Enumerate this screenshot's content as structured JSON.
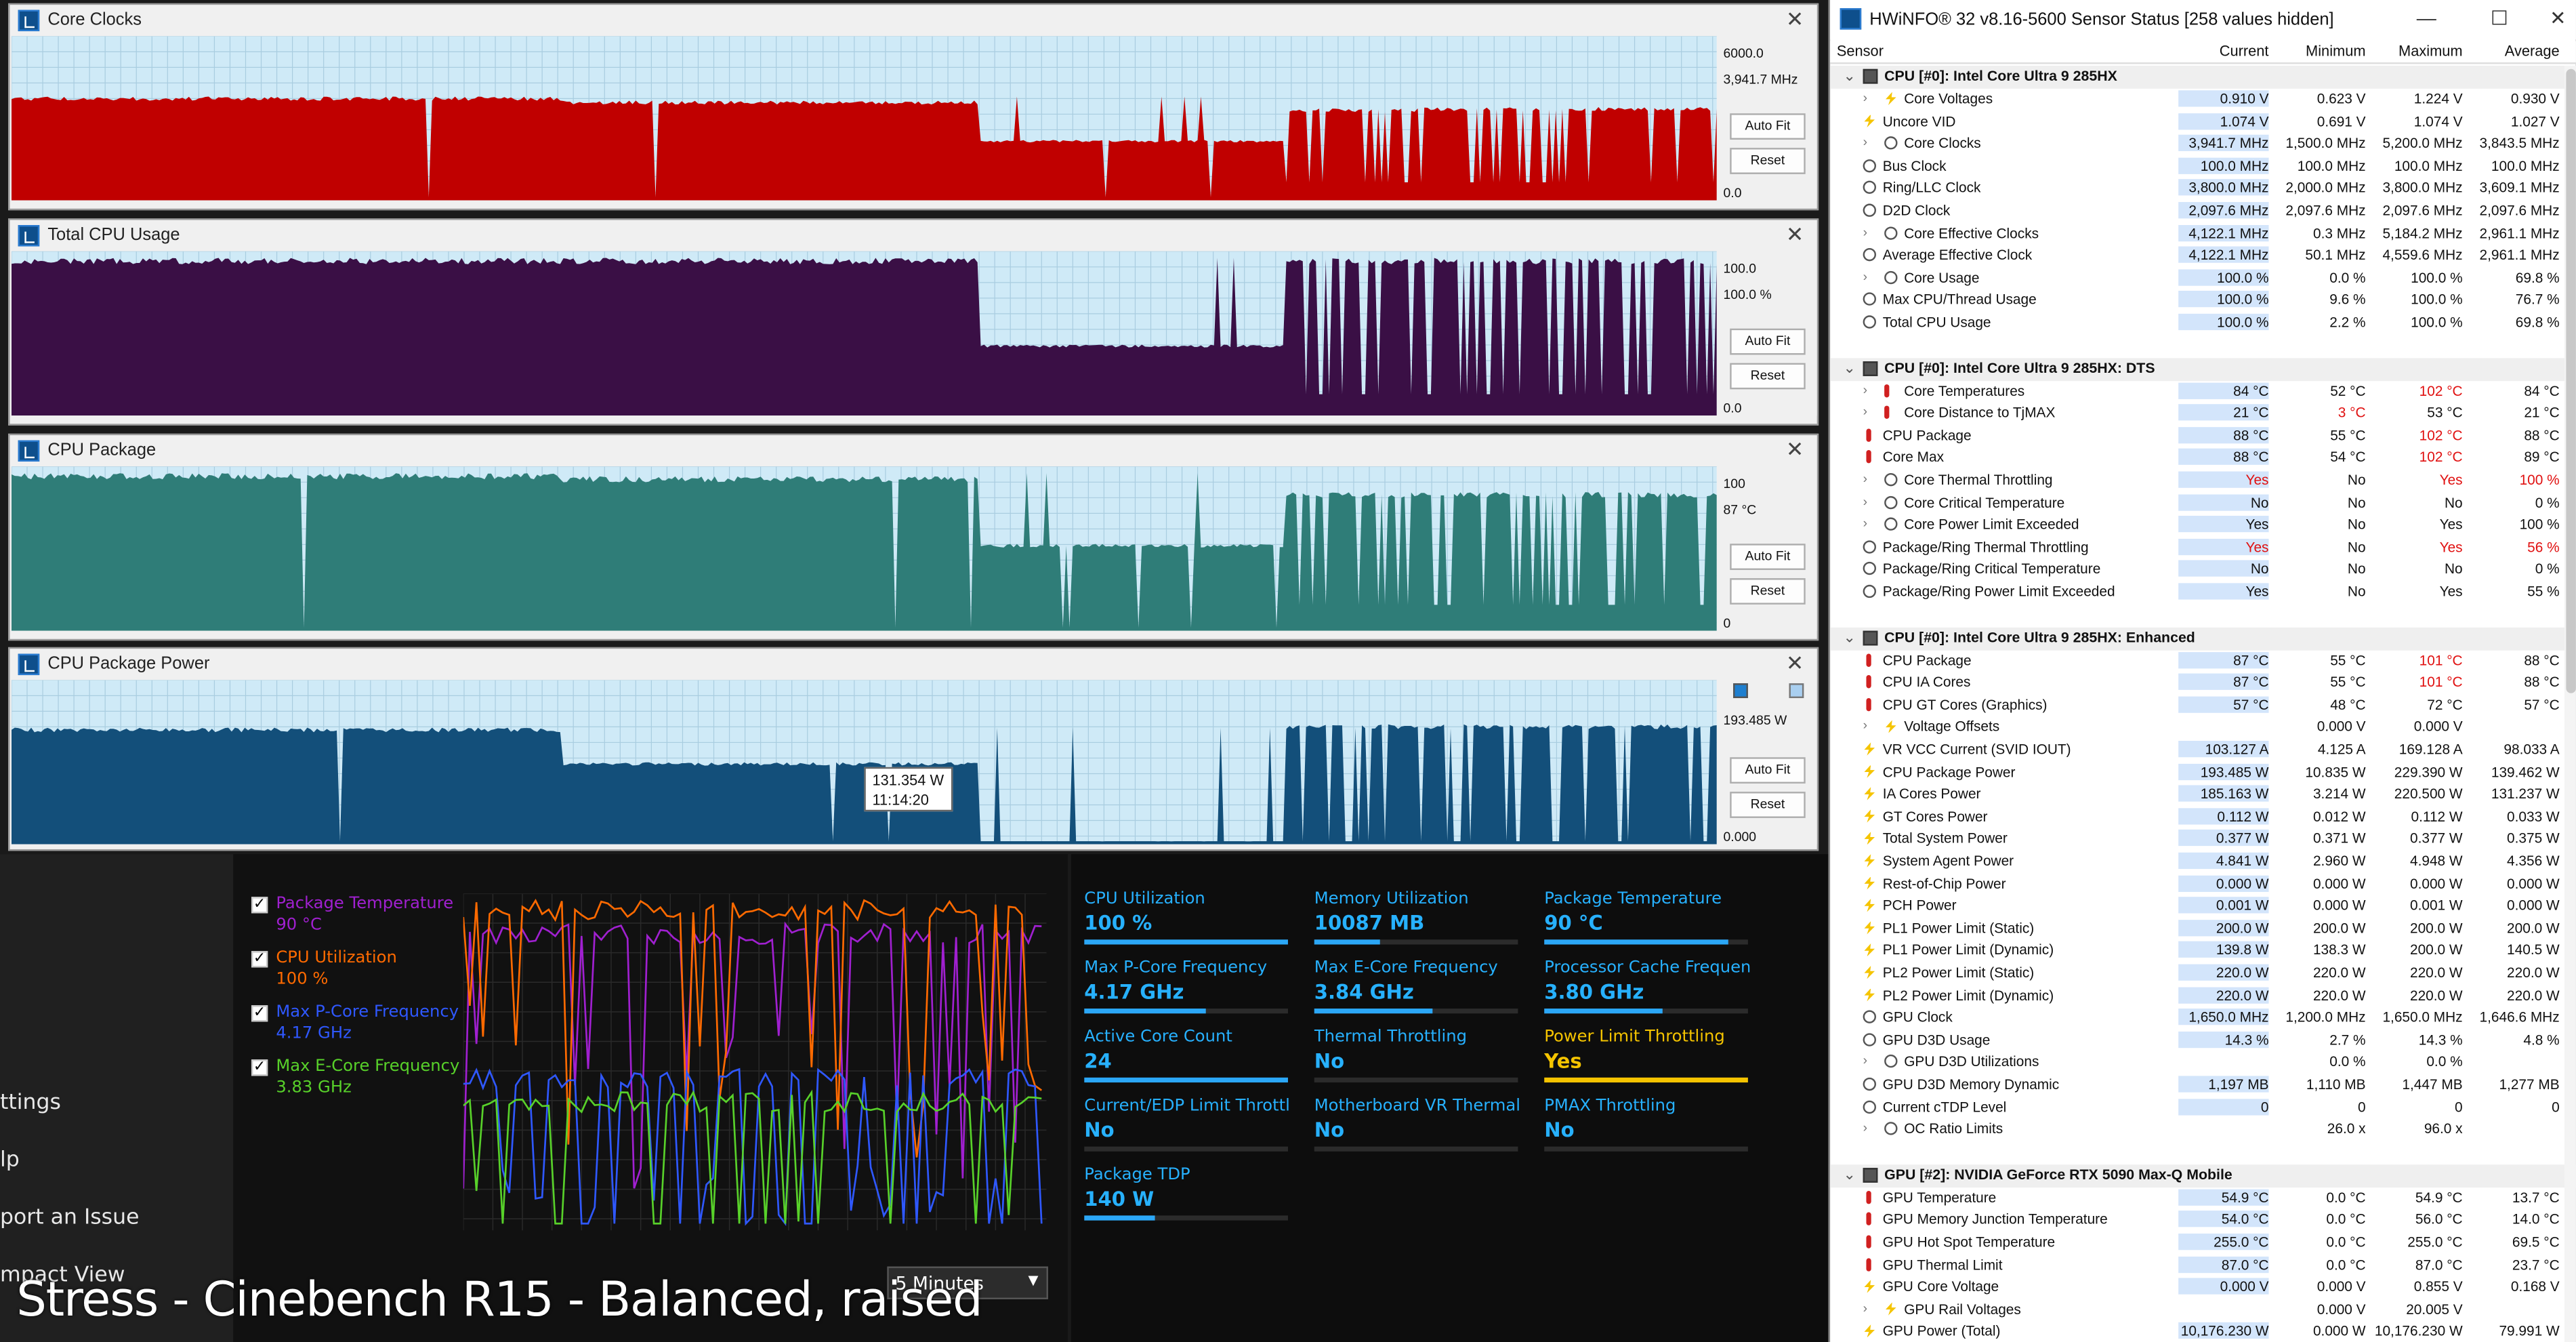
{
  "caption": "Stress - Cinebench R15 - Balanced, raised",
  "background_app": {
    "menu": [
      "ttings",
      "lp",
      "port an Issue",
      "mpact View"
    ],
    "legend": [
      {
        "name": "Package Temperature",
        "value": "90 °C",
        "color": "#a020d0"
      },
      {
        "name": "CPU Utilization",
        "value": "100 %",
        "color": "#ff6a00"
      },
      {
        "name": "Max P-Core Frequency",
        "value": "4.17 GHz",
        "color": "#2f58ff"
      },
      {
        "name": "Max E-Core Frequency",
        "value": "3.83 GHz",
        "color": "#58d12a"
      }
    ],
    "time_range": "5 Minutes",
    "stats": [
      {
        "label": "CPU Utilization",
        "value": "100 %",
        "level": 1.0
      },
      {
        "label": "Memory Utilization",
        "value": "10087 MB",
        "level": 0.32
      },
      {
        "label": "Package Temperature",
        "value": "90 °C",
        "level": 0.9
      },
      {
        "label": "Max P-Core Frequency",
        "value": "4.17 GHz",
        "level": 0.6
      },
      {
        "label": "Max E-Core Frequency",
        "value": "3.84 GHz",
        "level": 0.58
      },
      {
        "label": "Processor Cache Frequency",
        "value": "3.80 GHz",
        "level": 0.58
      },
      {
        "label": "Active Core Count",
        "value": "24",
        "level": 1.0
      },
      {
        "label": "Thermal Throttling",
        "value": "No",
        "level": 0
      },
      {
        "label": "Power Limit Throttling",
        "value": "Yes",
        "level": 1.0,
        "alert": true
      },
      {
        "label": "Current/EDP Limit Throttli...",
        "value": "No",
        "level": 0
      },
      {
        "label": "Motherboard VR Thermal...",
        "value": "No",
        "level": 0
      },
      {
        "label": "PMAX Throttling",
        "value": "No",
        "level": 0
      },
      {
        "label": "Package TDP",
        "value": "140 W",
        "level": 0.35
      }
    ]
  },
  "graphs": [
    {
      "title": "Core Clocks",
      "max": "6000.0",
      "current": "3,941.7 MHz",
      "min": "0.0",
      "color": "#c00000",
      "scale_max": 6000,
      "levels": {
        "a": 3950,
        "b": 3800,
        "c": 2300,
        "d": 3500,
        "e": 3550
      }
    },
    {
      "title": "Total CPU Usage",
      "max": "100.0",
      "current": "100.0 %",
      "min": "0.0",
      "color": "#3a0f45",
      "scale_max": 100,
      "levels": {
        "a": 100,
        "b": 100,
        "c": 45,
        "d": 100,
        "e": 100
      }
    },
    {
      "title": "CPU Package",
      "max": "100",
      "current": "87 °C",
      "min": "0",
      "color": "#2f7d78",
      "scale_max": 100,
      "levels": {
        "a": 100,
        "b": 98,
        "c": 55,
        "d": 88,
        "e": 88
      }
    },
    {
      "title": "CPU Package Power",
      "max": "",
      "current": "193.485 W",
      "min": "0.000",
      "color": "#134f7a",
      "scale_max": 250,
      "levels": {
        "a": 185,
        "b": 130,
        "c": 5,
        "d": 190,
        "e": 190
      }
    }
  ],
  "graph_buttons": {
    "auto_fit": "Auto Fit",
    "reset": "Reset"
  },
  "tooltip": {
    "value": "131.354 W",
    "time": "11:14:20"
  },
  "hwinfo": {
    "title": "HWiNFO® 32 v8.16-5600 Sensor Status [258 values hidden]",
    "columns": [
      "Sensor",
      "Current",
      "Minimum",
      "Maximum",
      "Average"
    ],
    "groups": [
      {
        "title": "CPU [#0]: Intel Core Ultra 9 285HX",
        "rows": [
          {
            "name": "Core Voltages",
            "icon": "bolt",
            "exp": true,
            "v": [
              "0.910 V",
              "0.623 V",
              "1.224 V",
              "0.930 V"
            ]
          },
          {
            "name": "Uncore VID",
            "icon": "bolt",
            "v": [
              "1.074 V",
              "0.691 V",
              "1.074 V",
              "1.027 V"
            ]
          },
          {
            "name": "Core Clocks",
            "icon": "clock",
            "exp": true,
            "v": [
              "3,941.7 MHz",
              "1,500.0 MHz",
              "5,200.0 MHz",
              "3,843.5 MHz"
            ]
          },
          {
            "name": "Bus Clock",
            "icon": "clock",
            "v": [
              "100.0 MHz",
              "100.0 MHz",
              "100.0 MHz",
              "100.0 MHz"
            ]
          },
          {
            "name": "Ring/LLC Clock",
            "icon": "clock",
            "v": [
              "3,800.0 MHz",
              "2,000.0 MHz",
              "3,800.0 MHz",
              "3,609.1 MHz"
            ]
          },
          {
            "name": "D2D Clock",
            "icon": "clock",
            "v": [
              "2,097.6 MHz",
              "2,097.6 MHz",
              "2,097.6 MHz",
              "2,097.6 MHz"
            ]
          },
          {
            "name": "Core Effective Clocks",
            "icon": "clock",
            "exp": true,
            "v": [
              "4,122.1 MHz",
              "0.3 MHz",
              "5,184.2 MHz",
              "2,961.1 MHz"
            ]
          },
          {
            "name": "Average Effective Clock",
            "icon": "clock",
            "v": [
              "4,122.1 MHz",
              "50.1 MHz",
              "4,559.6 MHz",
              "2,961.1 MHz"
            ]
          },
          {
            "name": "Core Usage",
            "icon": "clock",
            "exp": true,
            "v": [
              "100.0 %",
              "0.0 %",
              "100.0 %",
              "69.8 %"
            ]
          },
          {
            "name": "Max CPU/Thread Usage",
            "icon": "clock",
            "v": [
              "100.0 %",
              "9.6 %",
              "100.0 %",
              "76.7 %"
            ]
          },
          {
            "name": "Total CPU Usage",
            "icon": "clock",
            "v": [
              "100.0 %",
              "2.2 %",
              "100.0 %",
              "69.8 %"
            ]
          }
        ]
      },
      {
        "title": "CPU [#0]: Intel Core Ultra 9 285HX: DTS",
        "rows": [
          {
            "name": "Core Temperatures",
            "icon": "therm",
            "exp": true,
            "v": [
              "84 °C",
              "52 °C",
              "102 °C",
              "84 °C"
            ],
            "red": [
              2
            ]
          },
          {
            "name": "Core Distance to TjMAX",
            "icon": "therm",
            "exp": true,
            "v": [
              "21 °C",
              "3 °C",
              "53 °C",
              "21 °C"
            ],
            "red": [
              1
            ]
          },
          {
            "name": "CPU Package",
            "icon": "therm",
            "v": [
              "88 °C",
              "55 °C",
              "102 °C",
              "88 °C"
            ],
            "red": [
              2
            ]
          },
          {
            "name": "Core Max",
            "icon": "therm",
            "v": [
              "88 °C",
              "54 °C",
              "102 °C",
              "89 °C"
            ],
            "red": [
              2
            ]
          },
          {
            "name": "Core Thermal Throttling",
            "icon": "clock",
            "exp": true,
            "v": [
              "Yes",
              "No",
              "Yes",
              "100 %"
            ],
            "red": [
              0,
              2,
              3
            ]
          },
          {
            "name": "Core Critical Temperature",
            "icon": "clock",
            "exp": true,
            "v": [
              "No",
              "No",
              "No",
              "0 %"
            ]
          },
          {
            "name": "Core Power Limit Exceeded",
            "icon": "clock",
            "exp": true,
            "v": [
              "Yes",
              "No",
              "Yes",
              "100 %"
            ]
          },
          {
            "name": "Package/Ring Thermal Throttling",
            "icon": "clock",
            "v": [
              "Yes",
              "No",
              "Yes",
              "56 %"
            ],
            "red": [
              0,
              2,
              3
            ]
          },
          {
            "name": "Package/Ring Critical Temperature",
            "icon": "clock",
            "v": [
              "No",
              "No",
              "No",
              "0 %"
            ]
          },
          {
            "name": "Package/Ring Power Limit Exceeded",
            "icon": "clock",
            "v": [
              "Yes",
              "No",
              "Yes",
              "55 %"
            ]
          }
        ]
      },
      {
        "title": "CPU [#0]: Intel Core Ultra 9 285HX: Enhanced",
        "rows": [
          {
            "name": "CPU Package",
            "icon": "therm",
            "v": [
              "87 °C",
              "55 °C",
              "101 °C",
              "88 °C"
            ],
            "red": [
              2
            ]
          },
          {
            "name": "CPU IA Cores",
            "icon": "therm",
            "v": [
              "87 °C",
              "55 °C",
              "101 °C",
              "88 °C"
            ],
            "red": [
              2
            ]
          },
          {
            "name": "CPU GT Cores (Graphics)",
            "icon": "therm",
            "v": [
              "57 °C",
              "48 °C",
              "72 °C",
              "57 °C"
            ]
          },
          {
            "name": "Voltage Offsets",
            "icon": "bolt",
            "exp": true,
            "v": [
              "",
              "0.000 V",
              "0.000 V",
              ""
            ]
          },
          {
            "name": "VR VCC Current (SVID IOUT)",
            "icon": "bolt",
            "v": [
              "103.127 A",
              "4.125 A",
              "169.128 A",
              "98.033 A"
            ]
          },
          {
            "name": "CPU Package Power",
            "icon": "bolt",
            "v": [
              "193.485 W",
              "10.835 W",
              "229.390 W",
              "139.462 W"
            ]
          },
          {
            "name": "IA Cores Power",
            "icon": "bolt",
            "v": [
              "185.163 W",
              "3.214 W",
              "220.500 W",
              "131.237 W"
            ]
          },
          {
            "name": "GT Cores Power",
            "icon": "bolt",
            "v": [
              "0.112 W",
              "0.012 W",
              "0.112 W",
              "0.033 W"
            ]
          },
          {
            "name": "Total System Power",
            "icon": "bolt",
            "v": [
              "0.377 W",
              "0.371 W",
              "0.377 W",
              "0.375 W"
            ]
          },
          {
            "name": "System Agent Power",
            "icon": "bolt",
            "v": [
              "4.841 W",
              "2.960 W",
              "4.948 W",
              "4.356 W"
            ]
          },
          {
            "name": "Rest-of-Chip Power",
            "icon": "bolt",
            "v": [
              "0.000 W",
              "0.000 W",
              "0.000 W",
              "0.000 W"
            ]
          },
          {
            "name": "PCH Power",
            "icon": "bolt",
            "v": [
              "0.001 W",
              "0.000 W",
              "0.001 W",
              "0.000 W"
            ]
          },
          {
            "name": "PL1 Power Limit (Static)",
            "icon": "bolt",
            "v": [
              "200.0 W",
              "200.0 W",
              "200.0 W",
              "200.0 W"
            ]
          },
          {
            "name": "PL1 Power Limit (Dynamic)",
            "icon": "bolt",
            "v": [
              "139.8 W",
              "138.3 W",
              "200.0 W",
              "140.5 W"
            ]
          },
          {
            "name": "PL2 Power Limit (Static)",
            "icon": "bolt",
            "v": [
              "220.0 W",
              "220.0 W",
              "220.0 W",
              "220.0 W"
            ]
          },
          {
            "name": "PL2 Power Limit (Dynamic)",
            "icon": "bolt",
            "v": [
              "220.0 W",
              "220.0 W",
              "220.0 W",
              "220.0 W"
            ]
          },
          {
            "name": "GPU Clock",
            "icon": "clock",
            "v": [
              "1,650.0 MHz",
              "1,200.0 MHz",
              "1,650.0 MHz",
              "1,646.6 MHz"
            ]
          },
          {
            "name": "GPU D3D Usage",
            "icon": "clock",
            "v": [
              "14.3 %",
              "2.7 %",
              "14.3 %",
              "4.8 %"
            ]
          },
          {
            "name": "GPU D3D Utilizations",
            "icon": "clock",
            "exp": true,
            "v": [
              "",
              "0.0 %",
              "0.0 %",
              ""
            ]
          },
          {
            "name": "GPU D3D Memory Dynamic",
            "icon": "clock",
            "v": [
              "1,197 MB",
              "1,110 MB",
              "1,447 MB",
              "1,277 MB"
            ]
          },
          {
            "name": "Current cTDP Level",
            "icon": "clock",
            "v": [
              "0",
              "0",
              "0",
              "0"
            ]
          },
          {
            "name": "OC Ratio Limits",
            "icon": "clock",
            "exp": true,
            "v": [
              "",
              "26.0 x",
              "96.0 x",
              ""
            ]
          }
        ]
      },
      {
        "title": "GPU [#2]: NVIDIA  GeForce RTX 5090 Max-Q Mobile",
        "rows": [
          {
            "name": "GPU Temperature",
            "icon": "therm",
            "v": [
              "54.9 °C",
              "0.0 °C",
              "54.9 °C",
              "13.7 °C"
            ]
          },
          {
            "name": "GPU Memory Junction Temperature",
            "icon": "therm",
            "v": [
              "54.0 °C",
              "0.0 °C",
              "56.0 °C",
              "14.0 °C"
            ]
          },
          {
            "name": "GPU Hot Spot Temperature",
            "icon": "therm",
            "v": [
              "255.0 °C",
              "0.0 °C",
              "255.0 °C",
              "69.5 °C"
            ]
          },
          {
            "name": "GPU Thermal Limit",
            "icon": "therm",
            "v": [
              "87.0 °C",
              "0.0 °C",
              "87.0 °C",
              "23.7 °C"
            ]
          },
          {
            "name": "GPU Core Voltage",
            "icon": "bolt",
            "v": [
              "0.000 V",
              "0.000 V",
              "0.855 V",
              "0.168 V"
            ]
          },
          {
            "name": "GPU Rail Voltages",
            "icon": "bolt",
            "exp": true,
            "v": [
              "",
              "0.000 V",
              "20.005 V",
              ""
            ]
          },
          {
            "name": "GPU Power (Total)",
            "icon": "bolt",
            "v": [
              "10,176.230 W",
              "0.000 W",
              "10,176.230 W",
              "79.991 W"
            ]
          }
        ]
      }
    ]
  }
}
